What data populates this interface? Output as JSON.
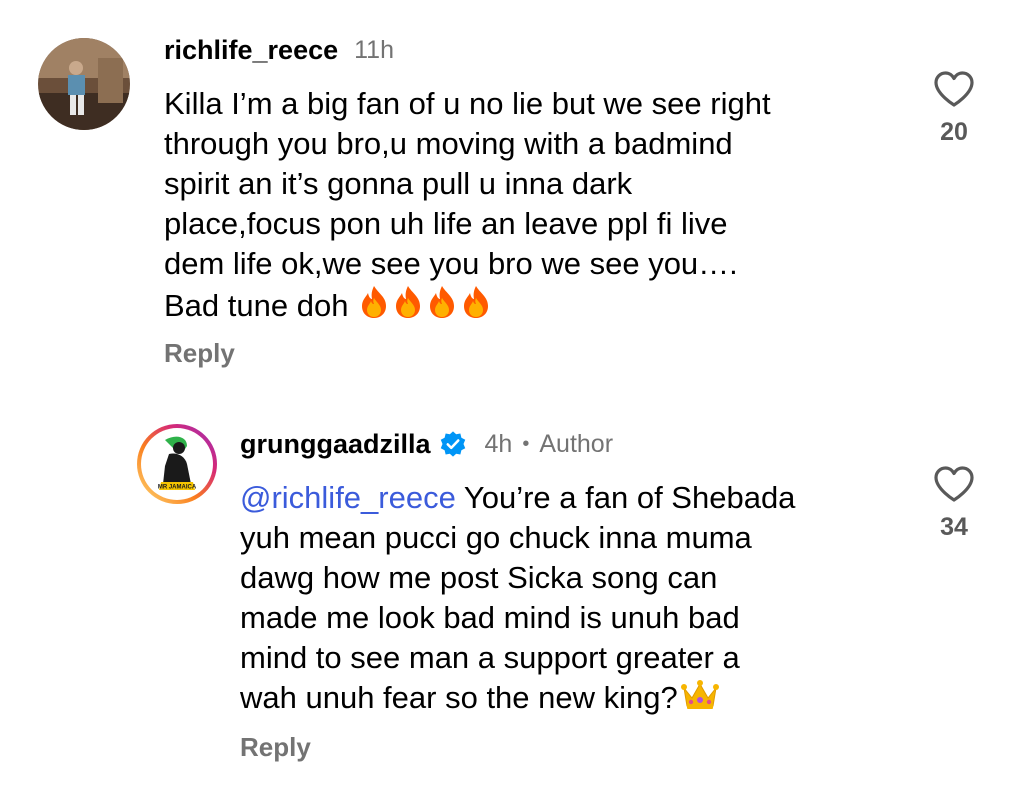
{
  "comments": [
    {
      "username": "richlife_reece",
      "time": "11h",
      "lines": [
        "Killa I’m a big fan of u no lie but we see right",
        "through you bro,u moving with a badmind",
        "spirit an it’s gonna pull u inna dark",
        "place,focus pon uh life an leave ppl fi live",
        "dem life ok,we see you bro we see you…."
      ],
      "last_line": "Bad tune doh",
      "emoji": [
        "fire-icon",
        "fire-icon",
        "fire-icon",
        "fire-icon"
      ],
      "reply_label": "Reply",
      "like_count": "20"
    },
    {
      "username": "grunggaadzilla",
      "time": "4h",
      "separator": "•",
      "author_label": "Author",
      "avatar_text": "MR JAMAICA",
      "mention": "@richlife_reece",
      "first_line_rest": " You’re a fan of Shebada",
      "lines": [
        "yuh mean pucci go chuck inna muma",
        "dawg how me post Sicka song can",
        "made me look bad mind is unuh bad",
        "mind to see man a support greater a"
      ],
      "last_line": "wah unuh fear so the new king?",
      "emoji": [
        "crown-icon"
      ],
      "reply_label": "Reply",
      "like_count": "34"
    }
  ],
  "colors": {
    "muted": "#737373",
    "mention": "#3b5bdb",
    "verified": "#0095f6",
    "fire": "#ff6d00"
  }
}
